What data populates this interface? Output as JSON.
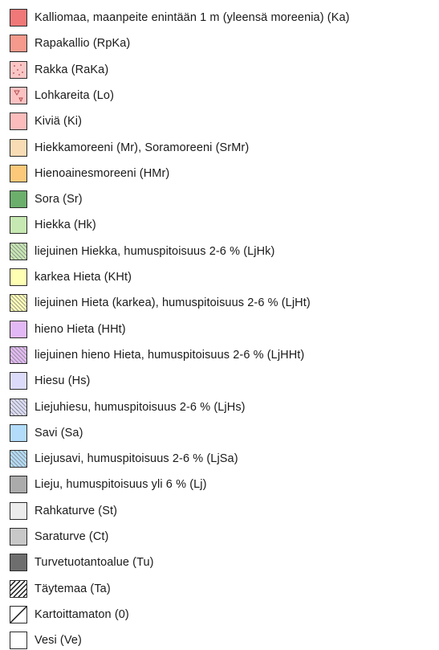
{
  "legend": {
    "items": [
      {
        "label": "Kalliomaa, maanpeite enintään 1 m (yleensä moreenia) (Ka)",
        "color": "#f07878",
        "pattern": "solid"
      },
      {
        "label": "Rapakallio (RpKa)",
        "color": "#f59a8c",
        "pattern": "solid"
      },
      {
        "label": "Rakka (RaKa)",
        "color": "#fbc6c6",
        "pattern": "dots"
      },
      {
        "label": "Lohkareita (Lo)",
        "color": "#fbc2c2",
        "pattern": "triangle"
      },
      {
        "label": "Kiviä (Ki)",
        "color": "#fcbcbc",
        "pattern": "solid"
      },
      {
        "label": "Hiekkamoreeni (Mr), Soramoreeni (SrMr)",
        "color": "#f7dcb5",
        "pattern": "solid"
      },
      {
        "label": "Hienoainesmoreeni (HMr)",
        "color": "#fcc97a",
        "pattern": "solid"
      },
      {
        "label": "Sora (Sr)",
        "color": "#6cae6c",
        "pattern": "solid"
      },
      {
        "label": "Hiekka (Hk)",
        "color": "#c6e8b2",
        "pattern": "solid"
      },
      {
        "label": "liejuinen Hiekka, humuspitoisuus 2-6 % (LjHk)",
        "color": "#c6e8b2",
        "pattern": "hatch"
      },
      {
        "label": "karkea Hieta (KHt)",
        "color": "#ffffb4",
        "pattern": "solid"
      },
      {
        "label": "liejuinen Hieta (karkea), humuspitoisuus 2-6 % (LjHt)",
        "color": "#ffffb4",
        "pattern": "hatch"
      },
      {
        "label": "hieno Hieta (HHt)",
        "color": "#e3b9f5",
        "pattern": "solid"
      },
      {
        "label": "liejuinen hieno Hieta, humuspitoisuus 2-6 % (LjHHt)",
        "color": "#e3b9f5",
        "pattern": "hatch"
      },
      {
        "label": "Hiesu (Hs)",
        "color": "#dcdcfa",
        "pattern": "solid"
      },
      {
        "label": "Liejuhiesu, humuspitoisuus 2-6 % (LjHs)",
        "color": "#dcdcfa",
        "pattern": "hatch"
      },
      {
        "label": "Savi (Sa)",
        "color": "#b2dcfa",
        "pattern": "solid"
      },
      {
        "label": "Liejusavi, humuspitoisuus 2-6 % (LjSa)",
        "color": "#b2dcfa",
        "pattern": "hatch"
      },
      {
        "label": "Lieju, humuspitoisuus yli 6 % (Lj)",
        "color": "#ababab",
        "pattern": "solid"
      },
      {
        "label": "Rahkaturve (St)",
        "color": "#ececec",
        "pattern": "solid"
      },
      {
        "label": "Saraturve (Ct)",
        "color": "#c8c8c8",
        "pattern": "solid"
      },
      {
        "label": "Turvetuotantoalue (Tu)",
        "color": "#6e6e6e",
        "pattern": "solid"
      },
      {
        "label": "Täytemaa (Ta)",
        "color": "#ffffff",
        "pattern": "bold-hatch"
      },
      {
        "label": "Kartoittamaton (0)",
        "color": "#ffffff",
        "pattern": "single-diagonal"
      },
      {
        "label": "Vesi (Ve)",
        "color": "#ffffff",
        "pattern": "solid"
      }
    ]
  }
}
